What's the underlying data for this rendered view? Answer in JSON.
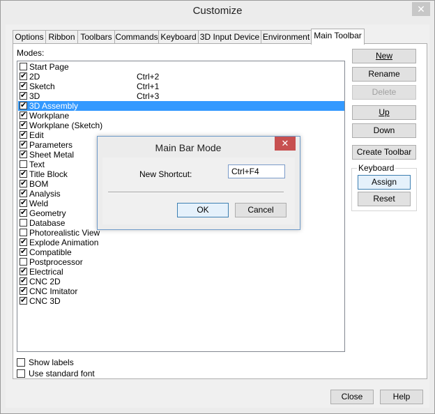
{
  "window": {
    "title": "Customize",
    "close_glyph": "✕"
  },
  "tabs": [
    {
      "label": "Options"
    },
    {
      "label": "Ribbon"
    },
    {
      "label": "Toolbars"
    },
    {
      "label": "Commands"
    },
    {
      "label": "Keyboard"
    },
    {
      "label": "3D Input Device"
    },
    {
      "label": "Environment"
    },
    {
      "label": "Main Toolbar"
    }
  ],
  "modes": {
    "label": "Modes:",
    "items": [
      {
        "label": "Start Page",
        "shortcut": "",
        "checked": false
      },
      {
        "label": "2D",
        "shortcut": "Ctrl+2",
        "checked": true
      },
      {
        "label": "Sketch",
        "shortcut": "Ctrl+1",
        "checked": true
      },
      {
        "label": "3D",
        "shortcut": "Ctrl+3",
        "checked": true
      },
      {
        "label": "3D Assembly",
        "shortcut": "",
        "checked": true,
        "selected": true
      },
      {
        "label": "Workplane",
        "shortcut": "",
        "checked": true
      },
      {
        "label": "Workplane (Sketch)",
        "shortcut": "",
        "checked": true
      },
      {
        "label": "Edit",
        "shortcut": "",
        "checked": true
      },
      {
        "label": "Parameters",
        "shortcut": "",
        "checked": true
      },
      {
        "label": "Sheet Metal",
        "shortcut": "",
        "checked": true
      },
      {
        "label": "Text",
        "shortcut": "",
        "checked": false
      },
      {
        "label": "Title Block",
        "shortcut": "",
        "checked": true
      },
      {
        "label": "BOM",
        "shortcut": "",
        "checked": true
      },
      {
        "label": "Analysis",
        "shortcut": "",
        "checked": true
      },
      {
        "label": "Weld",
        "shortcut": "",
        "checked": true
      },
      {
        "label": "Geometry",
        "shortcut": "",
        "checked": true
      },
      {
        "label": "Database",
        "shortcut": "",
        "checked": false
      },
      {
        "label": "Photorealistic View",
        "shortcut": "",
        "checked": false
      },
      {
        "label": "Explode Animation",
        "shortcut": "",
        "checked": true
      },
      {
        "label": "Compatible",
        "shortcut": "",
        "checked": true
      },
      {
        "label": "Postprocessor",
        "shortcut": "",
        "checked": false
      },
      {
        "label": "Electrical",
        "shortcut": "",
        "checked": true
      },
      {
        "label": "CNC 2D",
        "shortcut": "",
        "checked": true
      },
      {
        "label": "CNC Imitator",
        "shortcut": "",
        "checked": true
      },
      {
        "label": "CNC 3D",
        "shortcut": "",
        "checked": true
      }
    ]
  },
  "buttons": {
    "new": "New",
    "rename": "Rename",
    "delete": "Delete",
    "up": "Up",
    "down": "Down",
    "create_toolbar": "Create Toolbar"
  },
  "keyboard_group": {
    "label": "Keyboard",
    "assign": "Assign",
    "reset": "Reset"
  },
  "options": {
    "show_labels": "Show labels",
    "use_standard_font": "Use standard font"
  },
  "footer": {
    "close": "Close",
    "help": "Help"
  },
  "dialog": {
    "title": "Main Bar Mode",
    "close_glyph": "✕",
    "shortcut_label": "New Shortcut:",
    "shortcut_value": "Ctrl+F4",
    "ok": "OK",
    "cancel": "Cancel"
  },
  "check_glyph": "✔"
}
